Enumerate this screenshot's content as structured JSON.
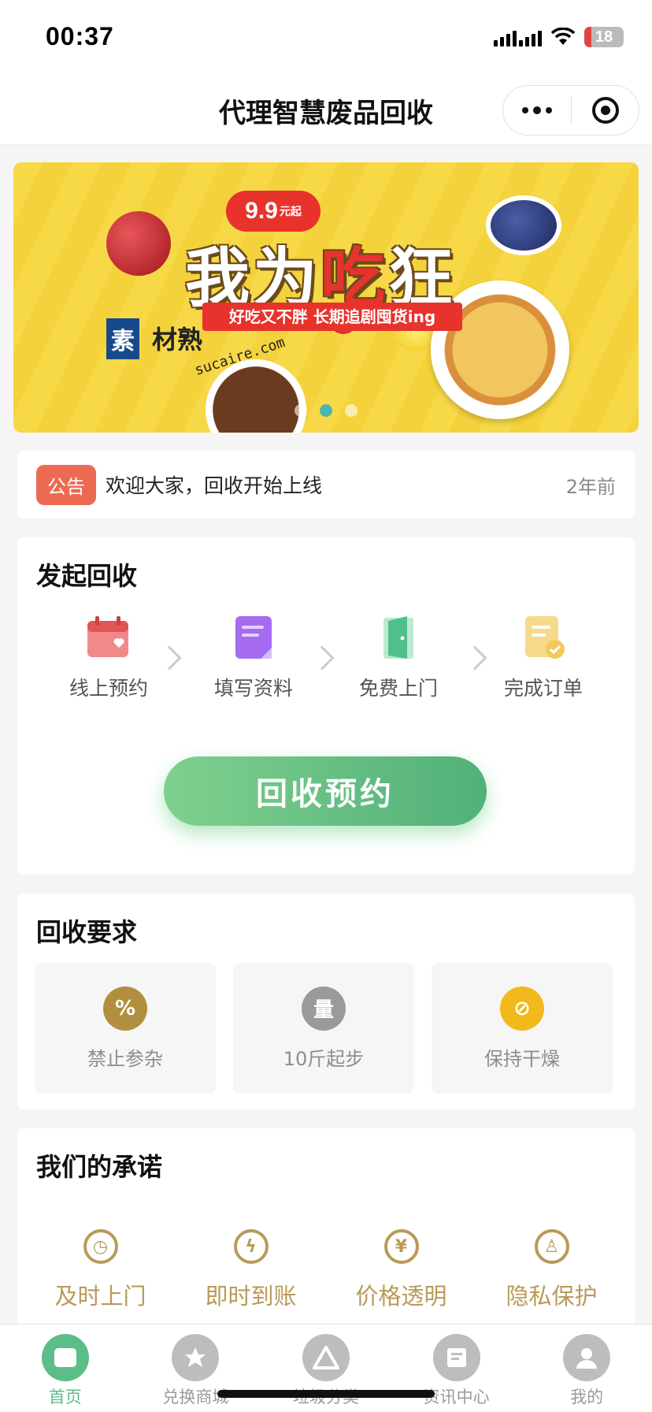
{
  "status_bar": {
    "time": "00:37",
    "battery": "18"
  },
  "title_bar": {
    "title": "代理智慧废品回收"
  },
  "banner": {
    "price_badge": "9.9",
    "price_unit": "元起",
    "headline_part1": "我为",
    "headline_part2": "吃",
    "headline_part3": "狂",
    "subline": "好吃又不胖 长期追剧囤货ing",
    "watermark_logo": "素",
    "watermark_text": "材熟",
    "watermark_url": "sucaire.com",
    "active_dot": 2
  },
  "notice": {
    "tag": "公告",
    "text": "欢迎大家，回收开始上线",
    "time": "2年前"
  },
  "initiate": {
    "title": "发起回收",
    "steps": [
      {
        "label": "线上预约",
        "icon": "calendar-icon",
        "color": "#ef6b6b"
      },
      {
        "label": "填写资料",
        "icon": "document-edit-icon",
        "color": "#a66bf0"
      },
      {
        "label": "免费上门",
        "icon": "door-icon",
        "color": "#4fc089"
      },
      {
        "label": "完成订单",
        "icon": "order-check-icon",
        "color": "#f4c95a"
      }
    ],
    "button": "回收预约"
  },
  "requirements": {
    "title": "回收要求",
    "items": [
      {
        "label": "禁止参杂",
        "icon": "no-mix-icon",
        "glyph": "%",
        "color": "#b28f3e"
      },
      {
        "label": "10斤起步",
        "icon": "weight-icon",
        "glyph": "量",
        "color": "#9a9a9a"
      },
      {
        "label": "保持干燥",
        "icon": "no-water-icon",
        "glyph": "⊘",
        "color": "#f2b91c"
      }
    ]
  },
  "promise": {
    "title": "我们的承诺",
    "items": [
      {
        "label": "及时上门",
        "icon": "clock-icon",
        "glyph": "◷"
      },
      {
        "label": "即时到账",
        "icon": "lightning-icon",
        "glyph": "ϟ"
      },
      {
        "label": "价格透明",
        "icon": "yen-icon",
        "glyph": "¥"
      },
      {
        "label": "隐私保护",
        "icon": "shield-icon",
        "glyph": "♙"
      }
    ]
  },
  "tabbar": {
    "tabs": [
      {
        "label": "首页",
        "icon": "home-icon",
        "active": true
      },
      {
        "label": "兑换商城",
        "icon": "star-icon",
        "active": false
      },
      {
        "label": "垃圾分类",
        "icon": "recycle-icon",
        "active": false
      },
      {
        "label": "资讯中心",
        "icon": "news-icon",
        "active": false
      },
      {
        "label": "我的",
        "icon": "user-icon",
        "active": false
      }
    ]
  },
  "colors": {
    "accent": "#5cbd88",
    "notice_tag": "#ec6a52",
    "promise": "#b99a58"
  }
}
